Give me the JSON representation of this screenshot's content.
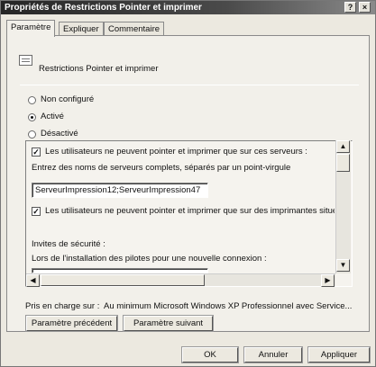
{
  "window": {
    "title": "Propriétés de Restrictions Pointer et imprimer",
    "help_label": "?",
    "close_label": "×"
  },
  "tabs": [
    {
      "label": "Paramètre",
      "active": true
    },
    {
      "label": "Expliquer",
      "active": false
    },
    {
      "label": "Commentaire",
      "active": false
    }
  ],
  "policy": {
    "icon": "policy-document-icon",
    "name": "Restrictions Pointer et imprimer"
  },
  "state": {
    "options": [
      {
        "label": "Non configuré",
        "selected": false
      },
      {
        "label": "Activé",
        "selected": true
      },
      {
        "label": "Désactivé",
        "selected": false
      }
    ]
  },
  "options_box": {
    "check1_label": "Les utilisateurs ne peuvent pointer et imprimer que sur ces serveurs :",
    "servers_hint": "Entrez des noms de serveurs complets, séparés par un point-virgule",
    "servers_value": "ServeurImpression12;ServeurImpression47",
    "check2_label": "Les utilisateurs ne peuvent pointer et imprimer que sur des imprimantes situées d",
    "security_heading": "Invites de sécurité :",
    "security_hint": "Lors de l'installation des pilotes pour une nouvelle connexion :",
    "check_mark": "✓",
    "scroll_up": "▲",
    "scroll_down": "▼",
    "scroll_left": "◀",
    "scroll_right": "▶"
  },
  "supported": {
    "label": "Pris en charge sur :",
    "value": "Au minimum Microsoft Windows XP Professionnel avec Service..."
  },
  "nav": {
    "prev_label": "Paramètre précédent",
    "next_label": "Paramètre suivant"
  },
  "footer": {
    "ok_label": "OK",
    "cancel_label": "Annuler",
    "apply_label": "Appliquer"
  }
}
